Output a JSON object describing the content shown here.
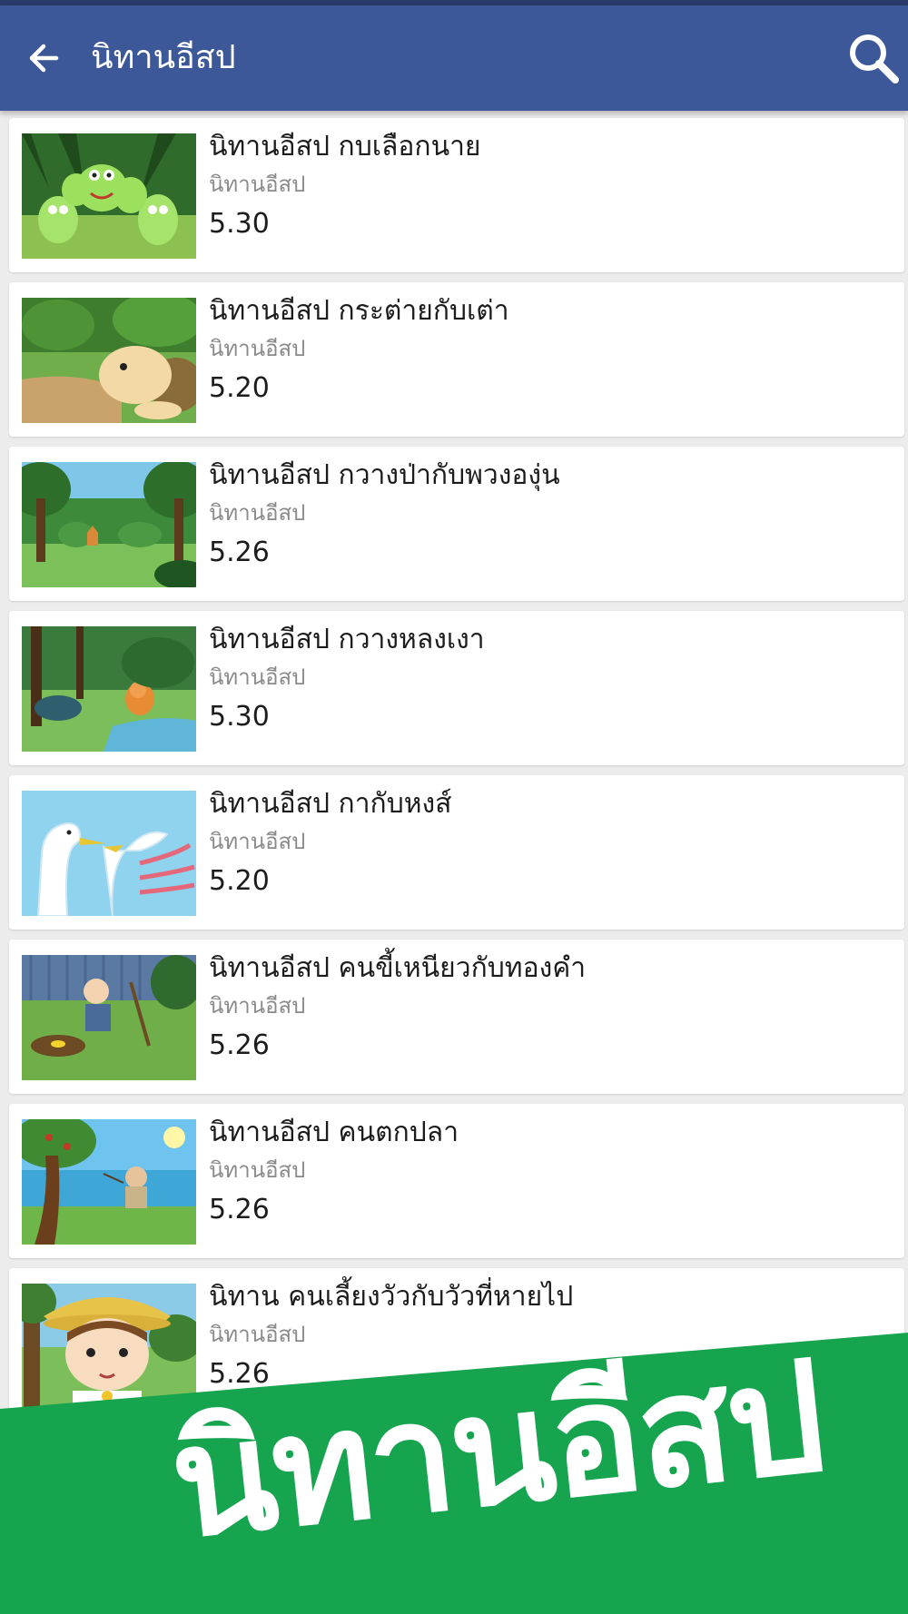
{
  "appbar": {
    "title": "นิทานอีสป",
    "back_icon": "arrow-left-icon",
    "search_icon": "search-icon",
    "background": "#3c5899"
  },
  "items": [
    {
      "title": "นิทานอีสป กบเลือกนาย",
      "channel": "นิทานอีสป",
      "duration": "5.30"
    },
    {
      "title": "นิทานอีสป กระต่ายกับเต่า",
      "channel": "นิทานอีสป",
      "duration": "5.20"
    },
    {
      "title": "นิทานอีสป กวางป่ากับพวงองุ่น",
      "channel": "นิทานอีสป",
      "duration": "5.26"
    },
    {
      "title": "นิทานอีสป กวางหลงเงา",
      "channel": "นิทานอีสป",
      "duration": "5.30"
    },
    {
      "title": "นิทานอีสป กากับหงส์",
      "channel": "นิทานอีสป",
      "duration": "5.20"
    },
    {
      "title": "นิทานอีสป คนขี้เหนียวกับทองคำ",
      "channel": "นิทานอีสป",
      "duration": "5.26"
    },
    {
      "title": "นิทานอีสป คนตกปลา",
      "channel": "นิทานอีสป",
      "duration": "5.26"
    },
    {
      "title": "นิทาน คนเลี้ยงวัวกับวัวที่หายไป",
      "channel": "นิทานอีสป",
      "duration": "5.26"
    }
  ],
  "banner": {
    "text": "นิทานอีสป",
    "color": "#16a44f"
  }
}
